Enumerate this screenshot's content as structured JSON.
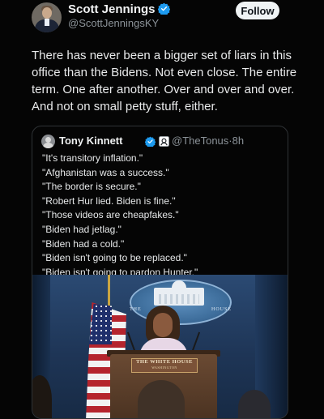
{
  "author": {
    "name": "Scott Jennings",
    "handle": "@ScottJenningsKY",
    "verified_color": "#1d9bf0"
  },
  "follow_button": {
    "label": "Follow"
  },
  "post": {
    "lines": [
      "There has never been a bigger set of liars in this",
      "office than the Bidens. Not even close. The entire",
      "term. One after another. Over and over and over.",
      "And not on small petty stuff, either."
    ]
  },
  "quoted_post": {
    "name": "Tony Kinnett",
    "handle": "@TheTonus",
    "separator": "·",
    "time": "8h",
    "badges": [
      "verified-badge",
      "affiliate-badge"
    ],
    "lines": [
      "\"It's transitory inflation.\"",
      "\"Afghanistan was a success.\"",
      "\"The border is secure.\"",
      "\"Robert Hur lied. Biden is fine.\"",
      "\"Those videos are cheapfakes.\"",
      "\"Biden had jetlag.\"",
      "\"Biden had a cold.\"",
      "\"Biden isn't going to be replaced.\"",
      "\"Biden isn't going to pardon Hunter.\""
    ],
    "photo": {
      "podium_text": "THE WHITE HOUSE",
      "podium_subtext": "WASHINGTON",
      "seal_text_left": "THE",
      "seal_text_right": "HOUSE"
    }
  },
  "colors": {
    "background": "#050505",
    "text": "#e7e9ea",
    "secondary_text": "#8b9298",
    "card_border": "#2f3336",
    "follow_bg": "#eff3f4"
  }
}
